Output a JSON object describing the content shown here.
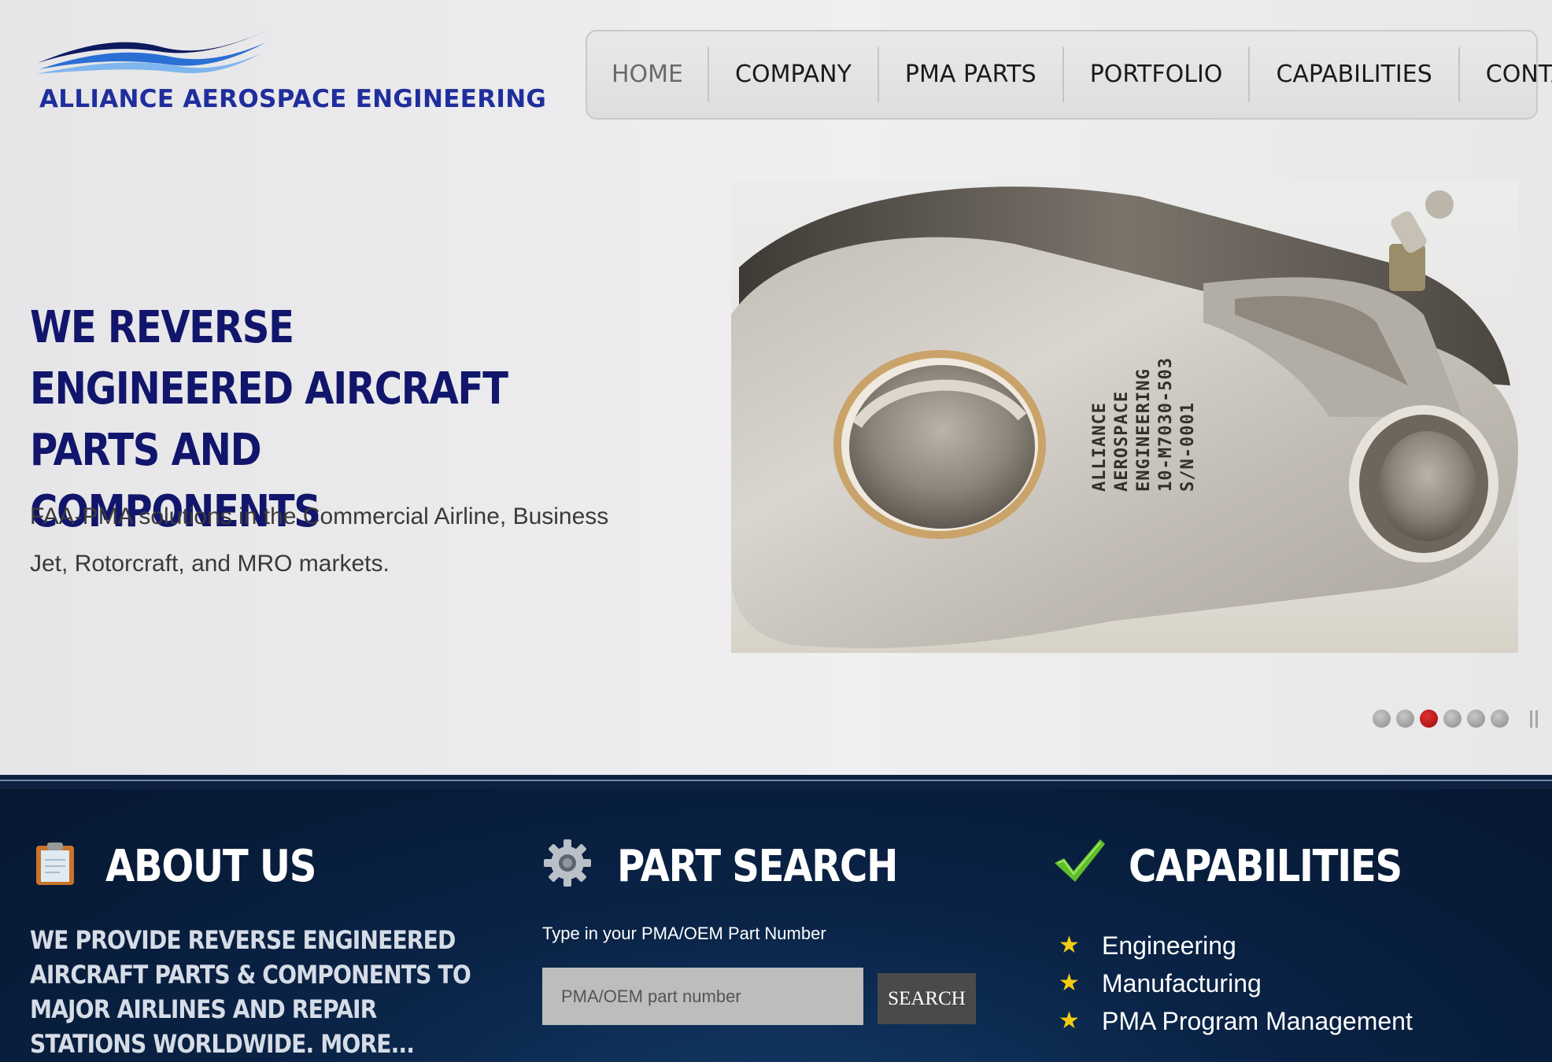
{
  "header": {
    "logo_text": "ALLIANCE AEROSPACE ENGINEERING"
  },
  "nav": {
    "items": [
      {
        "label": "HOME"
      },
      {
        "label": "COMPANY"
      },
      {
        "label": "PMA PARTS"
      },
      {
        "label": "PORTFOLIO"
      },
      {
        "label": "CAPABILITIES"
      },
      {
        "label": "CONTACT"
      }
    ],
    "active": "HOME"
  },
  "hero": {
    "heading": "WE REVERSE ENGINEERED AIRCRAFT PARTS AND COMPONENTS",
    "subtext": "FAA-PMA solutions in the Commercial Airline, Business Jet, Rotorcraft, and MRO markets.",
    "part_engraving": [
      "ALLIANCE",
      "AEROSPACE",
      "ENGINEERING",
      "10-M7030-503",
      "S/N-0001"
    ],
    "slider": {
      "count": 6,
      "active_index": 3
    }
  },
  "about": {
    "icon": "clipboard-icon",
    "title": "ABOUT US",
    "text": "WE PROVIDE REVERSE ENGINEERED AIRCRAFT PARTS & COMPONENTS TO MAJOR AIRLINES AND REPAIR STATIONS WORLDWIDE. MORE..."
  },
  "part_search": {
    "icon": "gear-icon",
    "title": "PART SEARCH",
    "label": "Type in your PMA/OEM Part Number",
    "placeholder": "PMA/OEM part number",
    "value": "",
    "button": "SEARCH"
  },
  "capabilities": {
    "icon": "checkmark-icon",
    "title": "CAPABILITIES",
    "items": [
      "Engineering",
      "Manufacturing",
      "PMA Program Management"
    ]
  },
  "colors": {
    "brand_navy": "#11166c",
    "logo_blue": "#1f2e9c",
    "band_background": "#0a2346",
    "star_yellow": "#f3cc12",
    "active_dot": "#c81414"
  }
}
